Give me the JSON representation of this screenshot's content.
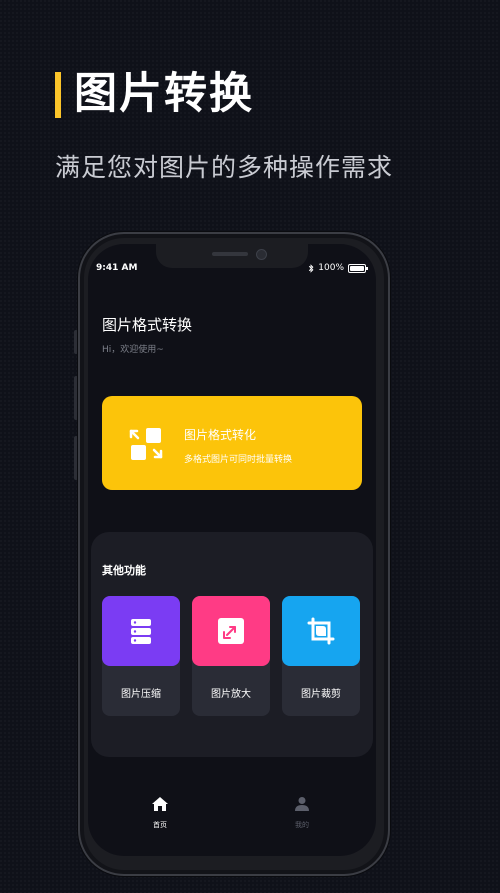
{
  "promo": {
    "title": "图片转换",
    "subtitle": "满足您对图片的多种操作需求",
    "accent": "#fcc52a"
  },
  "status_bar": {
    "time": "9:41 AM",
    "battery": "100%",
    "icons": [
      "bluetooth-icon",
      "battery-icon"
    ]
  },
  "header": {
    "title": "图片格式转换",
    "greeting": "Hi，欢迎使用~"
  },
  "hero": {
    "title": "图片格式转化",
    "subtitle": "多格式图片可同时批量转换",
    "color": "#fcc40a",
    "icon": "format-convert-icon"
  },
  "others": {
    "title": "其他功能",
    "items": [
      {
        "label": "图片压缩",
        "color": "#7b3cf3",
        "icon": "compress-icon"
      },
      {
        "label": "图片放大",
        "color": "#ff3b85",
        "icon": "enlarge-icon"
      },
      {
        "label": "图片裁剪",
        "color": "#16a5f0",
        "icon": "crop-icon"
      }
    ]
  },
  "tabbar": {
    "items": [
      {
        "label": "首页",
        "icon": "home-icon",
        "active": true
      },
      {
        "label": "我的",
        "icon": "user-icon",
        "active": false
      }
    ]
  }
}
